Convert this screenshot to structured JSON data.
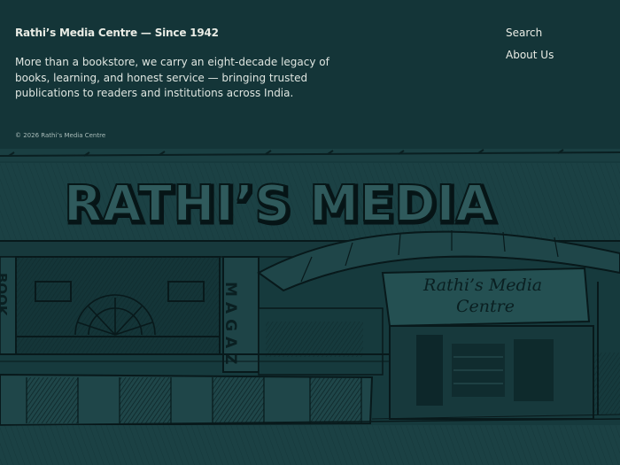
{
  "footer": {
    "brand_title": "Rathi’s Media Centre — Since 1942",
    "description": "More than a bookstore, we carry an eight-decade legacy of books, learning, and honest service — bringing trusted publications to readers and institutions across India.",
    "copyright": "© 2026 Rathi’s Media Centre",
    "nav": [
      {
        "label": "Search"
      },
      {
        "label": "About Us"
      }
    ]
  },
  "storefront": {
    "sign_text": "RATHI’S MEDIA",
    "left_sign": "BOOK",
    "magazine_sign": "MAGAZ",
    "banner_line1": "Rathi’s Media",
    "banner_line2": "Centre"
  }
}
